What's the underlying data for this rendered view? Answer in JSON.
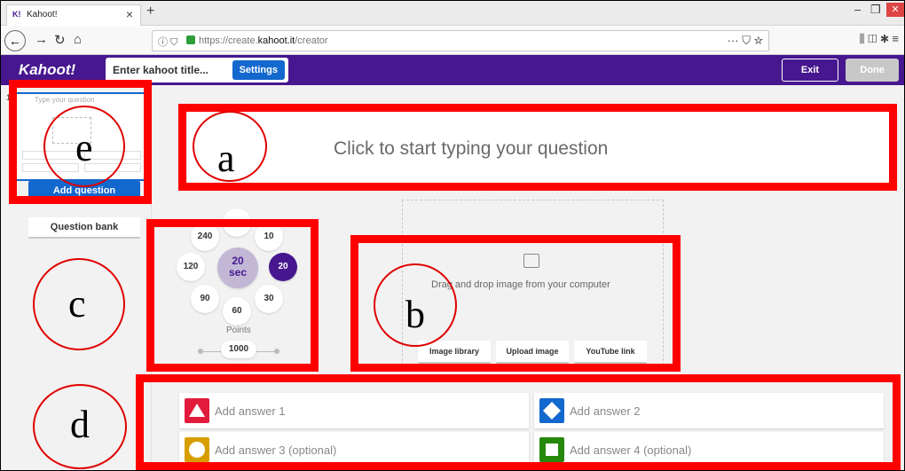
{
  "browser": {
    "tab_favicon": "K!",
    "tab_title": "Kahoot!",
    "url_prefix": "https://create.",
    "url_domain": "kahoot.it",
    "url_path": "/creator",
    "icons": [
      "back-icon",
      "forward-icon",
      "reload-icon",
      "home-icon",
      "info-icon",
      "shield-icon",
      "lock-icon",
      "more-icon",
      "pocket-icon",
      "star-icon",
      "library-icon",
      "sidebar-icon",
      "extension-icon",
      "menu-icon"
    ]
  },
  "header": {
    "logo": "Kahoot!",
    "title_placeholder": "Enter kahoot title...",
    "settings_label": "Settings",
    "exit_label": "Exit",
    "done_label": "Done",
    "colors": {
      "brand": "#46178f",
      "button_blue": "#1368ce"
    }
  },
  "sidebar": {
    "slide_number": "1",
    "slide_placeholder": "Type your question",
    "add_question_label": "Add question",
    "question_bank_label": "Question bank"
  },
  "question": {
    "placeholder": "Click to start typing your question"
  },
  "timer": {
    "options": [
      "240",
      "10",
      "120",
      "20",
      "90",
      "30",
      "60"
    ],
    "selected_number": "20",
    "selected_unit": "sec",
    "selected_option": "20",
    "points_label": "Points",
    "points_value": "1000"
  },
  "media": {
    "drop_text": "Drag and drop image from your computer",
    "image_library_label": "Image library",
    "upload_image_label": "Upload image",
    "youtube_link_label": "YouTube link"
  },
  "answers": [
    {
      "label": "Add answer 1",
      "color": "#e21b3c",
      "shape": "triangle"
    },
    {
      "label": "Add answer 2",
      "color": "#1368ce",
      "shape": "diamond"
    },
    {
      "label": "Add answer 3 (optional)",
      "color": "#d89e00",
      "shape": "circle"
    },
    {
      "label": "Add answer 4 (optional)",
      "color": "#26890c",
      "shape": "square"
    }
  ],
  "annotations": {
    "letters": {
      "a": "a",
      "b": "b",
      "c": "c",
      "d": "d",
      "e": "e"
    },
    "color": "#ff0000"
  }
}
